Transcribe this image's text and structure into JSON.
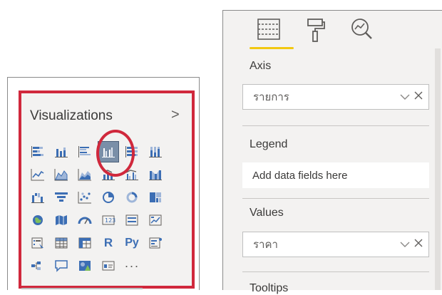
{
  "visualizations": {
    "title": "Visualizations",
    "expand_icon": ">",
    "icons": [
      "stacked-bar-chart-icon",
      "stacked-column-chart-icon",
      "clustered-bar-chart-icon",
      "clustered-column-chart-icon",
      "100-stacked-bar-chart-icon",
      "100-stacked-column-chart-icon",
      "line-chart-icon",
      "area-chart-icon",
      "stacked-area-chart-icon",
      "line-stacked-column-chart-icon",
      "line-clustered-column-chart-icon",
      "ribbon-chart-icon",
      "waterfall-chart-icon",
      "funnel-chart-icon",
      "scatter-chart-icon",
      "pie-chart-icon",
      "donut-chart-icon",
      "treemap-icon",
      "map-icon",
      "filled-map-icon",
      "gauge-icon",
      "card-icon",
      "multi-row-card-icon",
      "kpi-icon",
      "slicer-icon",
      "table-icon",
      "matrix-icon",
      "r-visual-icon",
      "python-visual-icon",
      "key-influencers-icon",
      "decomposition-tree-icon",
      "qa-icon",
      "arcgis-map-icon",
      "smart-narrative-icon",
      "more-visuals-icon"
    ],
    "r_label": "R",
    "py_label": "Py",
    "more_label": "···"
  },
  "fields_pane": {
    "tabs": [
      "fields-tab-icon",
      "format-paint-icon",
      "analytics-icon"
    ],
    "axis": {
      "label": "Axis",
      "value": "รายการ"
    },
    "legend": {
      "label": "Legend",
      "placeholder": "Add data fields here"
    },
    "values": {
      "label": "Values",
      "value": "ราคา"
    },
    "tooltips": {
      "label": "Tooltips"
    }
  }
}
